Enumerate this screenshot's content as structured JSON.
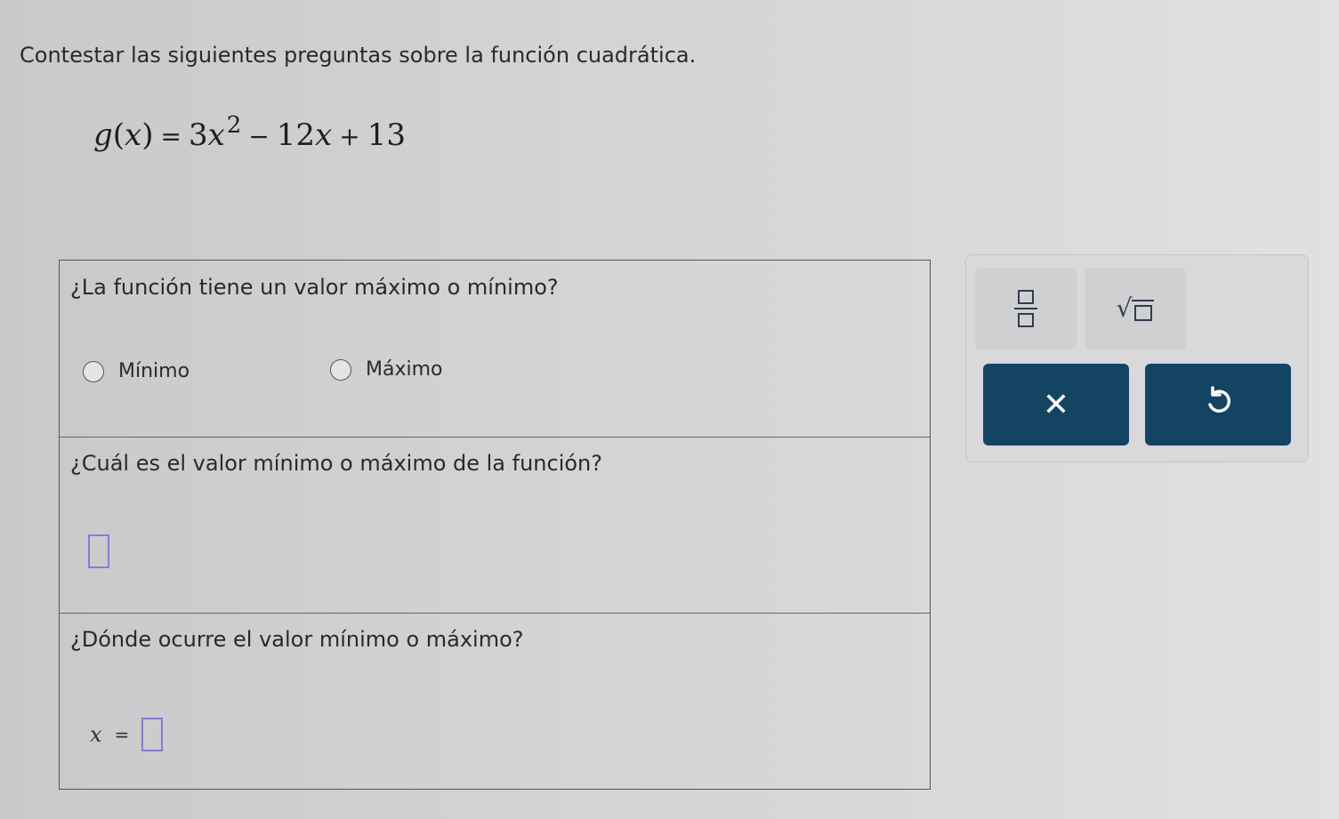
{
  "instruction": "Contestar las siguientes preguntas sobre la función cuadrática.",
  "equation": {
    "function_name": "g",
    "variable": "x",
    "coefficient_a": "3",
    "exponent": "2",
    "term_b": "12",
    "constant_c": "13",
    "minus_sign": "−",
    "plus_sign": "+",
    "equals_sign": "="
  },
  "question1": {
    "text": "¿La función tiene un valor máximo o mínimo?",
    "options": [
      "Mínimo",
      "Máximo"
    ],
    "selected": null
  },
  "question2": {
    "text": "¿Cuál es el valor mínimo o máximo de la función?",
    "answer_value": ""
  },
  "question3": {
    "text": "¿Dónde ocurre el valor mínimo o máximo?",
    "variable_label": "x",
    "equals": "=",
    "answer_value": ""
  },
  "toolbar": {
    "fraction_icon": "fraction-template-icon",
    "sqrt_icon": "square-root-template-icon",
    "sqrt_symbol": "√",
    "clear_symbol": "✕",
    "undo_symbol": "↺",
    "action_color": "#134563"
  }
}
